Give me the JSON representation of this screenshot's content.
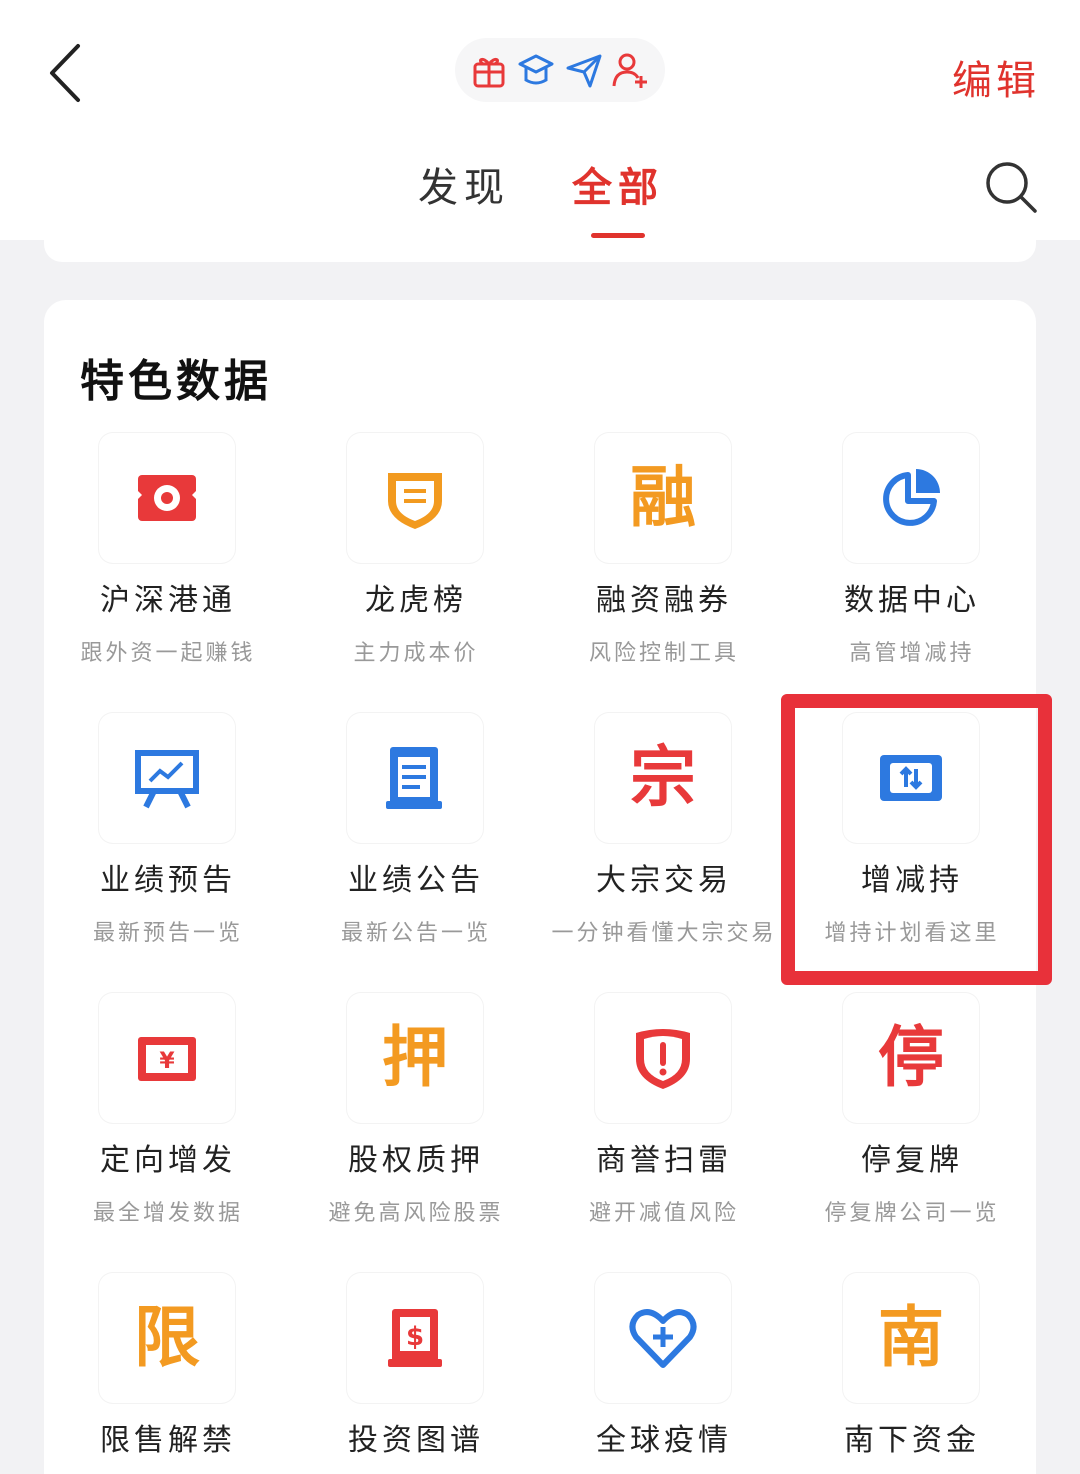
{
  "header": {
    "edit_label": "编辑",
    "top_icons": [
      "gift-icon",
      "graduation-cap-icon",
      "paper-plane-icon",
      "add-user-icon"
    ],
    "tabs": [
      {
        "label": "发现",
        "active": false
      },
      {
        "label": "全部",
        "active": true
      }
    ]
  },
  "section": {
    "title": "特色数据",
    "items": [
      {
        "label": "沪深港通",
        "desc": "跟外资一起赚钱",
        "icon": "hk-flag-icon",
        "color": "#e8393a"
      },
      {
        "label": "龙虎榜",
        "desc": "主力成本价",
        "icon": "shield-badge-icon",
        "color": "#f29a1f"
      },
      {
        "label": "融资融券",
        "desc": "风险控制工具",
        "icon": "rong-glyph-icon",
        "glyph": "融",
        "color": "#f39a21"
      },
      {
        "label": "数据中心",
        "desc": "高管增减持",
        "icon": "pie-chart-icon",
        "color": "#2d79e0"
      },
      {
        "label": "业绩预告",
        "desc": "最新预告一览",
        "icon": "presentation-chart-icon",
        "color": "#2d79e0"
      },
      {
        "label": "业绩公告",
        "desc": "最新公告一览",
        "icon": "document-icon",
        "color": "#2d79e0"
      },
      {
        "label": "大宗交易",
        "desc": "一分钟看懂大宗交易",
        "icon": "zong-glyph-icon",
        "glyph": "宗",
        "color": "#e8393a"
      },
      {
        "label": "增减持",
        "desc": "增持计划看这里",
        "icon": "up-down-exchange-icon",
        "color": "#2d79e0"
      },
      {
        "label": "定向增发",
        "desc": "最全增发数据",
        "icon": "yen-note-icon",
        "color": "#e8393a"
      },
      {
        "label": "股权质押",
        "desc": "避免高风险股票",
        "icon": "ya-glyph-icon",
        "glyph": "押",
        "color": "#f39a21"
      },
      {
        "label": "商誉扫雷",
        "desc": "避开减值风险",
        "icon": "alert-shield-icon",
        "color": "#e8393a"
      },
      {
        "label": "停复牌",
        "desc": "停复牌公司一览",
        "icon": "ting-glyph-icon",
        "glyph": "停",
        "color": "#e8393a"
      },
      {
        "label": "限售解禁",
        "desc": "",
        "icon": "xian-glyph-icon",
        "glyph": "限",
        "color": "#f39a21"
      },
      {
        "label": "投资图谱",
        "desc": "",
        "icon": "dollar-book-icon",
        "color": "#e8393a"
      },
      {
        "label": "全球疫情",
        "desc": "",
        "icon": "heart-plus-icon",
        "color": "#2d79e0"
      },
      {
        "label": "南下资金",
        "desc": "",
        "icon": "nan-glyph-icon",
        "glyph": "南",
        "color": "#f39a21"
      }
    ]
  }
}
